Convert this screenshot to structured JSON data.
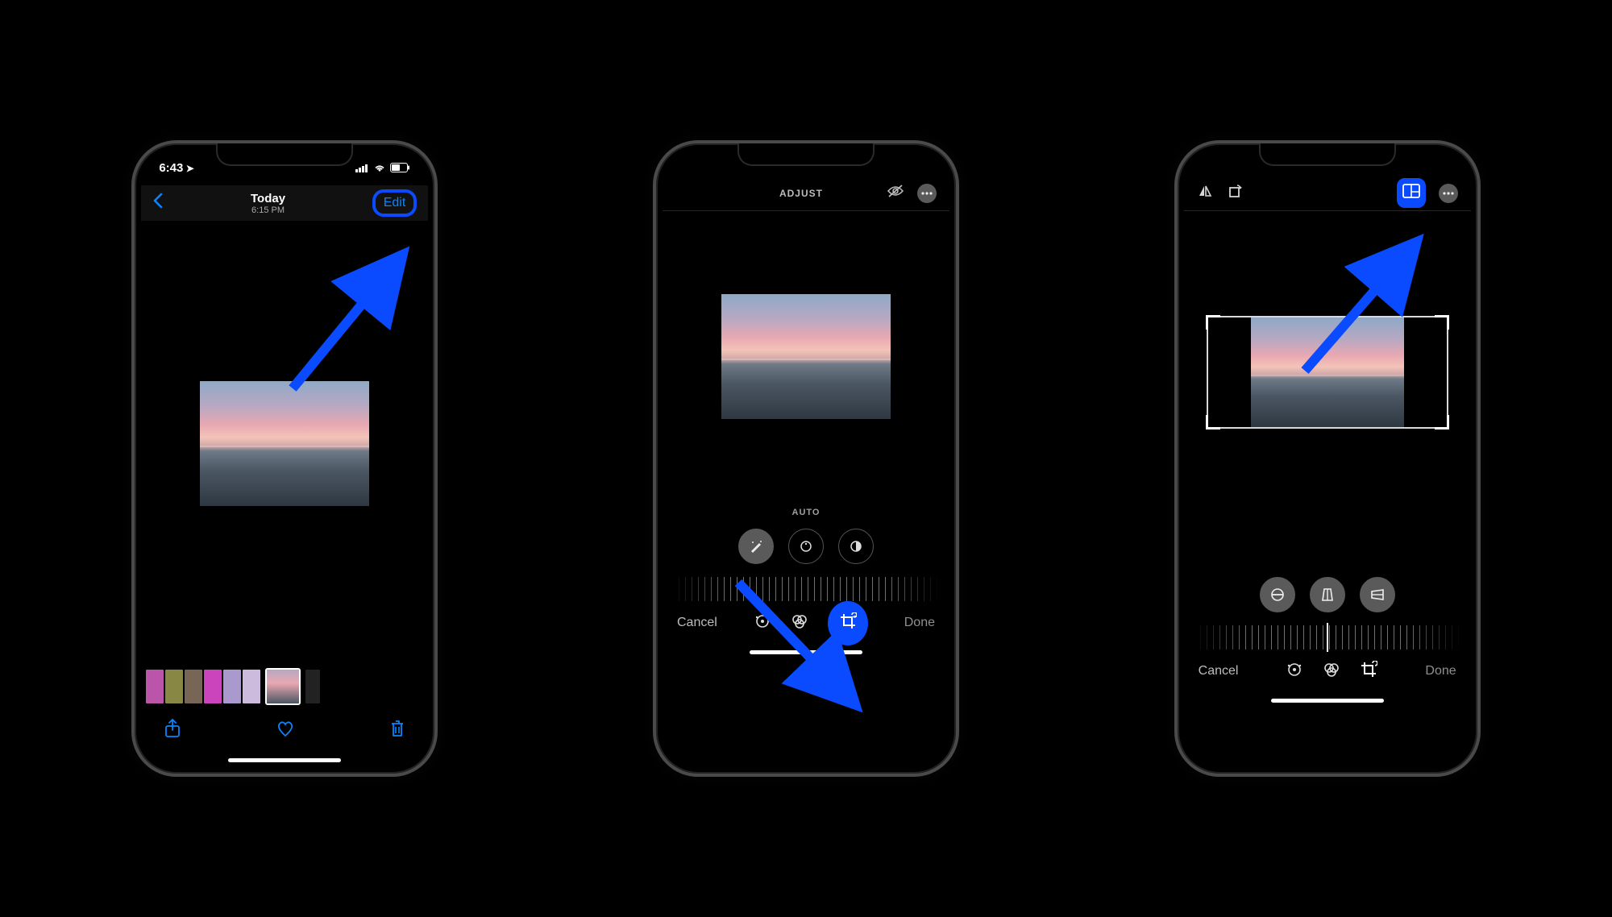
{
  "phone1": {
    "status_time": "6:43",
    "nav_title": "Today",
    "nav_subtitle": "6:15 PM",
    "edit_label": "Edit"
  },
  "phone2": {
    "top_title": "ADJUST",
    "auto_label": "AUTO",
    "cancel_label": "Cancel",
    "done_label": "Done"
  },
  "phone3": {
    "cancel_label": "Cancel",
    "done_label": "Done"
  },
  "colors": {
    "accent": "#0a84ff",
    "highlight": "#0a4bff"
  }
}
